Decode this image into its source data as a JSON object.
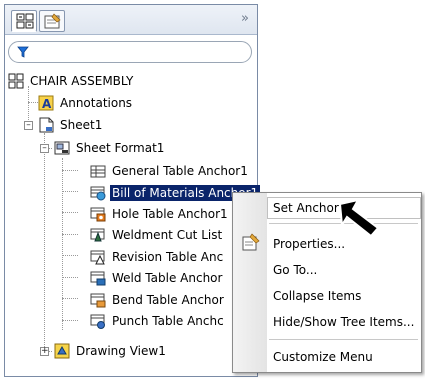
{
  "tabs": [
    {
      "icon": "feature-tree-icon"
    },
    {
      "icon": "property-manager-icon"
    }
  ],
  "collapse_icon": "double-chevron-icon",
  "filter": {
    "icon": "filter-icon"
  },
  "tree": {
    "root": {
      "label": "CHAIR ASSEMBLY",
      "icon": "assembly-icon"
    },
    "annotations": {
      "label": "Annotations",
      "icon": "annotations-icon"
    },
    "sheet": {
      "label": "Sheet1",
      "icon": "sheet-icon"
    },
    "sheet_format": {
      "label": "Sheet Format1",
      "icon": "sheet-format-icon"
    },
    "anchors": [
      {
        "label": "General Table Anchor1",
        "icon": "table-anchor-icon"
      },
      {
        "label": "Bill of Materials Anchor1",
        "icon": "bom-anchor-icon",
        "selected": true
      },
      {
        "label": "Hole Table Anchor1",
        "icon": "hole-table-anchor-icon"
      },
      {
        "label": "Weldment Cut List",
        "icon": "weldment-anchor-icon"
      },
      {
        "label": "Revision Table Anc",
        "icon": "revision-anchor-icon"
      },
      {
        "label": "Weld Table Anchor",
        "icon": "weld-anchor-icon"
      },
      {
        "label": "Bend Table Anchor",
        "icon": "bend-anchor-icon"
      },
      {
        "label": "Punch Table Anchc",
        "icon": "punch-anchor-icon"
      }
    ],
    "drawing_view": {
      "label": "Drawing View1",
      "icon": "drawing-view-icon"
    }
  },
  "context_menu": {
    "items": [
      {
        "label": "Set Anchor"
      },
      {
        "label": "Properties..."
      },
      {
        "label": "Go To..."
      },
      {
        "label": "Collapse Items"
      },
      {
        "label": "Hide/Show Tree Items..."
      },
      {
        "label": "Customize Menu"
      }
    ],
    "properties_icon": "properties-icon"
  },
  "cursor": {
    "icon": "arrow-cursor-icon"
  },
  "colors": {
    "selection": "#0a246a",
    "border": "#7a8ba6"
  }
}
